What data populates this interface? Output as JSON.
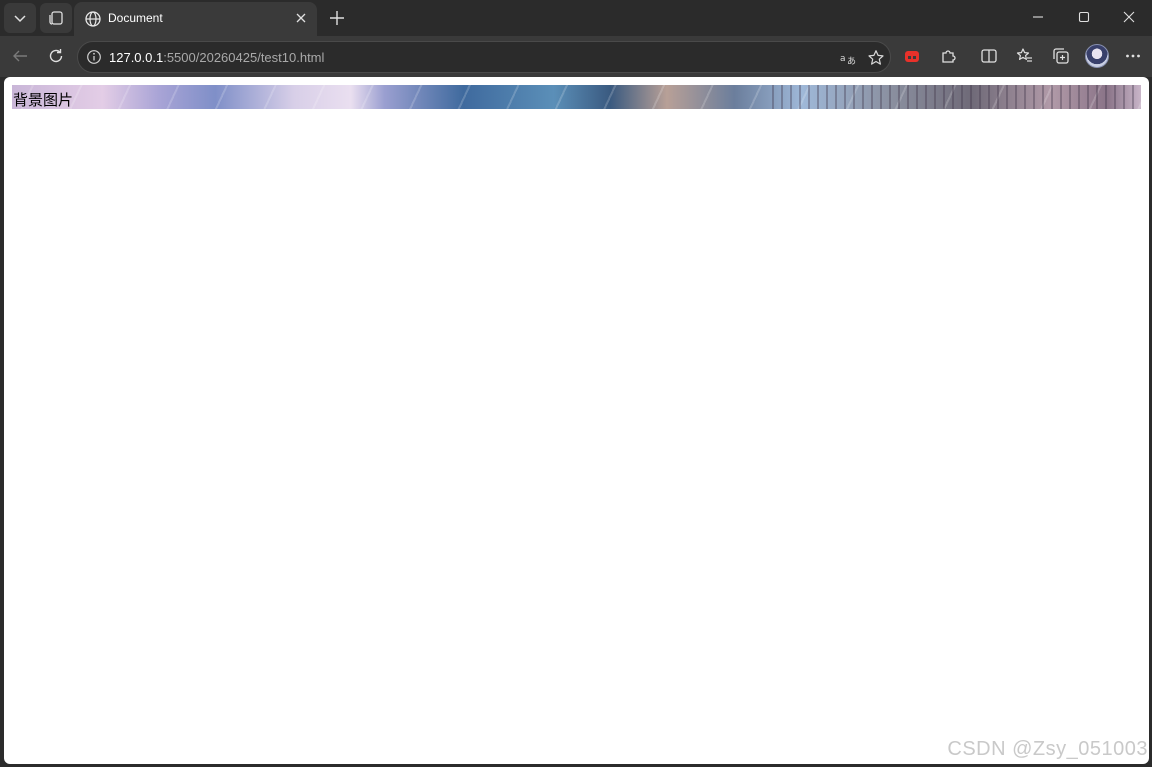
{
  "browser": {
    "tab": {
      "title": "Document"
    },
    "address": {
      "host": "127.0.0.1",
      "rest": ":5500/20260425/test10.html"
    }
  },
  "page": {
    "background_box_text": "背景图片"
  },
  "watermark": "CSDN @Zsy_051003",
  "colors": {
    "chrome_bg": "#2b2b2b",
    "toolbar_bg": "#3a3a3a",
    "page_bg": "#ffffff",
    "extension_red": "#e8312a"
  },
  "icons": [
    "tab-list-icon",
    "collections-icon",
    "globe-icon",
    "close-icon",
    "plus-icon",
    "minimize-icon",
    "maximize-icon",
    "window-close-icon",
    "back-icon",
    "refresh-icon",
    "info-icon",
    "read-aloud-icon",
    "star-icon",
    "extension-red-icon",
    "puzzle-icon",
    "split-screen-icon",
    "favorites-icon",
    "collections-add-icon",
    "more-icon"
  ]
}
